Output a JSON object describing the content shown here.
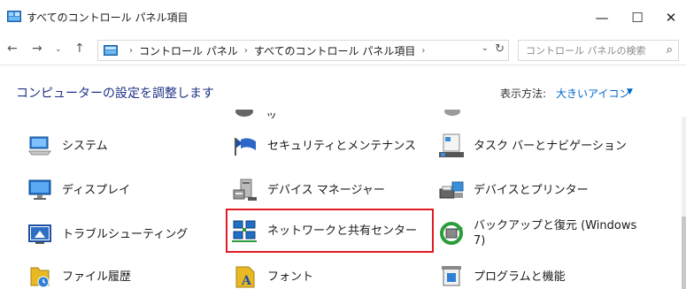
{
  "window": {
    "title": "すべてのコントロール パネル項目",
    "minimize_glyph": "—",
    "maximize_glyph": "☐",
    "close_glyph": "✕"
  },
  "nav": {
    "back_glyph": "←",
    "forward_glyph": "→",
    "recent_glyph": "⌄",
    "up_glyph": "↑",
    "breadcrumbs": [
      "コントロール パネル",
      "すべてのコントロール パネル項目"
    ],
    "breadcrumb_sep": "›",
    "addr_dropdown_glyph": "⌄",
    "refresh_glyph": "↻",
    "search_placeholder": "コントロール パネルの検索",
    "search_glyph": "⌕"
  },
  "header": {
    "title": "コンピューターの設定を調整します",
    "view_label": "表示方法:",
    "view_value": "大きいアイコン",
    "view_arrow": "▼"
  },
  "partial_row": [
    "",
    "ッ",
    ""
  ],
  "items": [
    {
      "label": "システム",
      "icon": "system-icon"
    },
    {
      "label": "セキュリティとメンテナンス",
      "icon": "security-flag-icon"
    },
    {
      "label": "タスク バーとナビゲーション",
      "icon": "taskbar-icon"
    },
    {
      "label": "ディスプレイ",
      "icon": "display-icon"
    },
    {
      "label": "デバイス マネージャー",
      "icon": "device-manager-icon"
    },
    {
      "label": "デバイスとプリンター",
      "icon": "devices-printers-icon"
    },
    {
      "label": "トラブルシューティング",
      "icon": "troubleshooting-icon"
    },
    {
      "label": "ネットワークと共有センター",
      "icon": "network-sharing-icon"
    },
    {
      "label": "バックアップと復元 (Windows 7)",
      "icon": "backup-restore-icon"
    },
    {
      "label": "ファイル履歴",
      "icon": "file-history-icon"
    },
    {
      "label": "フォント",
      "icon": "fonts-icon"
    },
    {
      "label": "プログラムと機能",
      "icon": "programs-features-icon"
    }
  ],
  "colors": {
    "title_blue": "#1e3287",
    "link_blue": "#0066cc",
    "highlight_red": "#e01b24"
  }
}
